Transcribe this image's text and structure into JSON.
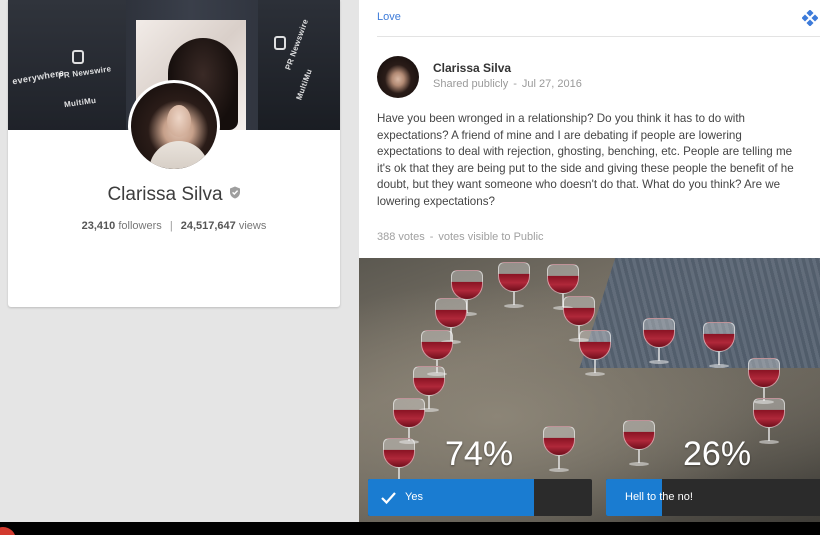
{
  "profile": {
    "name": "Clarissa Silva",
    "followers_count": "23,410",
    "followers_label": "followers",
    "views_count": "24,517,647",
    "views_label": "views",
    "separator": "|",
    "cover_signs": [
      "PR Newswire",
      "MultiMu",
      "everywhere",
      "PR Newswire",
      "MultiMu"
    ]
  },
  "post": {
    "community": "Love",
    "author_name": "Clarissa Silva",
    "visibility": "Shared publicly",
    "date": "Jul 27, 2016",
    "dot": "-",
    "text": "Have you been wronged in a relationship? Do you think it has to do with expectations? A friend of mine and I are debating if people are lowering expectations to deal with rejection, ghosting, benching, etc. People are telling me it's ok that they are being put to the side and giving these people the benefit of he doubt, but they want someone who doesn't do that. What do you think? Are we lowering expectations?",
    "votes": "388 votes",
    "votes_visibility": "votes visible to Public"
  },
  "poll": {
    "options": [
      {
        "label": "Yes",
        "percent_text": "74%",
        "percent": 0.74,
        "selected": true
      },
      {
        "label": "Hell to the no!",
        "percent_text": "26%",
        "percent": 0.26,
        "selected": false
      }
    ]
  },
  "colors": {
    "accent": "#1a7cd1",
    "link": "#3d7bd9",
    "option_bg": "#2b2b2b",
    "bottom_bar": "#000000"
  },
  "icons": {
    "verified": "verified-shield-icon",
    "community": "diamond-cluster-icon",
    "selected": "check-icon"
  }
}
